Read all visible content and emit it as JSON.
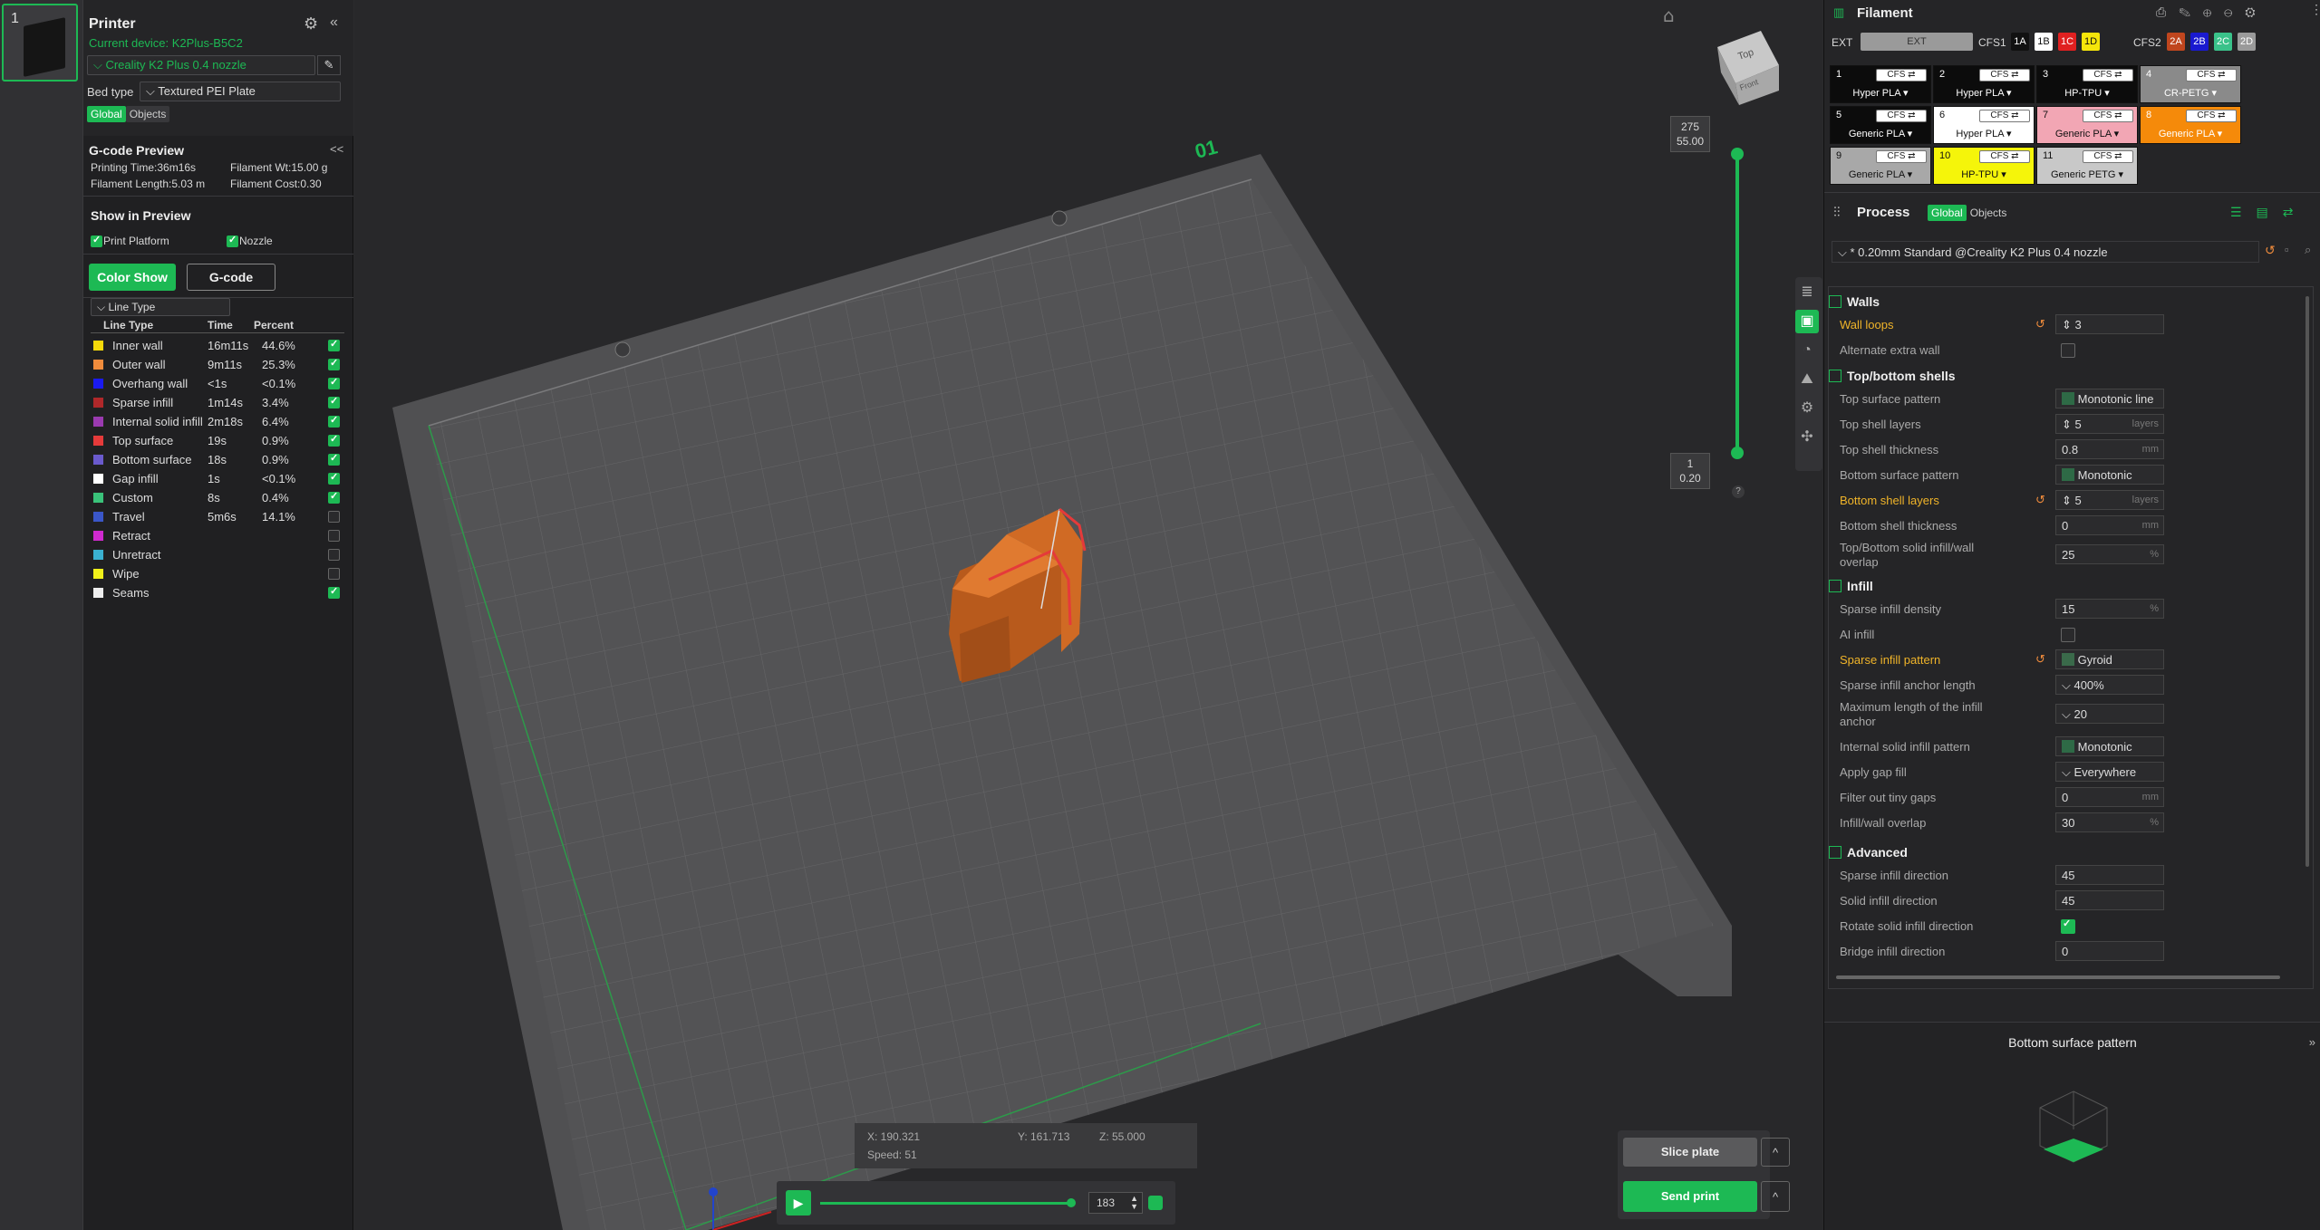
{
  "plate_thumb": {
    "number": "1"
  },
  "printer": {
    "title": "Printer",
    "current_device": "Current device: K2Plus-B5C2",
    "printer_name": "Creality K2 Plus 0.4 nozzle",
    "bed_type_label": "Bed type",
    "bed_type": "Textured PEI Plate",
    "tabs": [
      "Global",
      "Objects"
    ]
  },
  "gcode_preview": {
    "title": "G-code Preview",
    "collapse": "<<",
    "printing_time": "Printing Time:36m16s",
    "filament_wt": "Filament Wt:15.00 g",
    "filament_length": "Filament Length:5.03 m",
    "filament_cost": "Filament Cost:0.30",
    "show_in_preview": "Show in Preview",
    "print_platform": "Print Platform",
    "nozzle": "Nozzle",
    "color_show": "Color Show",
    "gcode": "G-code",
    "line_type_select": "Line Type",
    "table_headers": [
      "Line Type",
      "Time",
      "Percent"
    ],
    "rows": [
      {
        "name": "Inner wall",
        "time": "16m11s",
        "percent": "44.6%",
        "color": "#f5d90a",
        "checked": true
      },
      {
        "name": "Outer wall",
        "time": "9m11s",
        "percent": "25.3%",
        "color": "#f08c3c",
        "checked": true
      },
      {
        "name": "Overhang wall",
        "time": "<1s",
        "percent": "<0.1%",
        "color": "#1a1af0",
        "checked": true
      },
      {
        "name": "Sparse infill",
        "time": "1m14s",
        "percent": "3.4%",
        "color": "#b0282a",
        "checked": true
      },
      {
        "name": "Internal solid infill",
        "time": "2m18s",
        "percent": "6.4%",
        "color": "#9a3ab0",
        "checked": true
      },
      {
        "name": "Top surface",
        "time": "19s",
        "percent": "0.9%",
        "color": "#e53a3a",
        "checked": true
      },
      {
        "name": "Bottom surface",
        "time": "18s",
        "percent": "0.9%",
        "color": "#6a5acd",
        "checked": true
      },
      {
        "name": "Gap infill",
        "time": "1s",
        "percent": "<0.1%",
        "color": "#ffffff",
        "checked": true
      },
      {
        "name": "Custom",
        "time": "8s",
        "percent": "0.4%",
        "color": "#3ac27a",
        "checked": true
      },
      {
        "name": "Travel",
        "time": "5m6s",
        "percent": "14.1%",
        "color": "#3a56c8",
        "checked": false
      },
      {
        "name": "Retract",
        "time": "",
        "percent": "",
        "color": "#d02ad0",
        "checked": false
      },
      {
        "name": "Unretract",
        "time": "",
        "percent": "",
        "color": "#3ab0d0",
        "checked": false
      },
      {
        "name": "Wipe",
        "time": "",
        "percent": "",
        "color": "#f0f01a",
        "checked": false
      },
      {
        "name": "Seams",
        "time": "",
        "percent": "",
        "color": "#eeeeee",
        "checked": true
      }
    ]
  },
  "viewport": {
    "plate_label": "01",
    "view_cube_top": "Top",
    "view_cube_front": "Front",
    "layer_top_num": "275",
    "layer_top_height": "55.00",
    "layer_bottom_num": "1",
    "layer_bottom_height": "0.20",
    "help": "?",
    "coords": {
      "x": "X: 190.321",
      "y": "Y: 161.713",
      "z": "Z: 55.000",
      "speed": "Speed: 51"
    },
    "move_value": "183",
    "slice_plate": "Slice plate",
    "send_print": "Send print",
    "caret": "^"
  },
  "filament": {
    "title": "Filament",
    "ext_label": "EXT",
    "ext_btn": "EXT",
    "cfs1_label": "CFS1",
    "cfs2_label": "CFS2",
    "cfs1_slots": [
      {
        "label": "1A",
        "bg": "#111111",
        "fg": "#ffffff"
      },
      {
        "label": "1B",
        "bg": "#ffffff",
        "fg": "#111111"
      },
      {
        "label": "1C",
        "bg": "#e02020",
        "fg": "#ffffff"
      },
      {
        "label": "1D",
        "bg": "#f5e50a",
        "fg": "#111111"
      }
    ],
    "cfs2_slots": [
      {
        "label": "2A",
        "bg": "#c0461e",
        "fg": "#ffffff"
      },
      {
        "label": "2B",
        "bg": "#1a1ad0",
        "fg": "#ffffff"
      },
      {
        "label": "2C",
        "bg": "#3ac28a",
        "fg": "#ffffff"
      },
      {
        "label": "2D",
        "bg": "#9a9a9a",
        "fg": "#ffffff"
      }
    ],
    "cells": [
      {
        "idx": "1",
        "cfs": "CFS ⇄",
        "mat": "Hyper PLA ▾",
        "bg": "#0c0c0c",
        "fg": "#ffffff"
      },
      {
        "idx": "2",
        "cfs": "CFS ⇄",
        "mat": "Hyper PLA ▾",
        "bg": "#0c0c0c",
        "fg": "#ffffff"
      },
      {
        "idx": "3",
        "cfs": "CFS ⇄",
        "mat": "HP-TPU ▾",
        "bg": "#0c0c0c",
        "fg": "#ffffff"
      },
      {
        "idx": "4",
        "cfs": "CFS ⇄",
        "mat": "CR-PETG ▾",
        "bg": "#8a8a8a",
        "fg": "#ffffff"
      },
      {
        "idx": "5",
        "cfs": "CFS ⇄",
        "mat": "Generic PLA ▾",
        "bg": "#0c0c0c",
        "fg": "#ffffff"
      },
      {
        "idx": "6",
        "cfs": "CFS ⇄",
        "mat": "Hyper PLA ▾",
        "bg": "#ffffff",
        "fg": "#111111"
      },
      {
        "idx": "7",
        "cfs": "CFS ⇄",
        "mat": "Generic PLA ▾",
        "bg": "#f2a6b4",
        "fg": "#111111"
      },
      {
        "idx": "8",
        "cfs": "CFS ⇄",
        "mat": "Generic PLA ▾",
        "bg": "#f58a0a",
        "fg": "#ffffff"
      },
      {
        "idx": "9",
        "cfs": "CFS ⇄",
        "mat": "Generic PLA ▾",
        "bg": "#a8a8a8",
        "fg": "#111111"
      },
      {
        "idx": "10",
        "cfs": "CFS ⇄",
        "mat": "HP-TPU ▾",
        "bg": "#f5f50a",
        "fg": "#111111"
      },
      {
        "idx": "11",
        "cfs": "CFS ⇄",
        "mat": "Generic PETG ▾",
        "bg": "#c8c8c8",
        "fg": "#111111"
      }
    ]
  },
  "process": {
    "title": "Process",
    "tabs": [
      "Global",
      "Objects"
    ],
    "preset": "* 0.20mm Standard @Creality K2 Plus 0.4 nozzle",
    "sections": {
      "walls": "Walls",
      "top_bottom": "Top/bottom shells",
      "infill": "Infill",
      "advanced": "Advanced"
    },
    "rows": {
      "wall_loops": {
        "label": "Wall loops",
        "value": "3"
      },
      "alt_extra_wall": {
        "label": "Alternate extra wall"
      },
      "top_surface_pattern": {
        "label": "Top surface pattern",
        "value": "Monotonic line"
      },
      "top_shell_layers": {
        "label": "Top shell layers",
        "value": "5",
        "unit": "layers"
      },
      "top_shell_thickness": {
        "label": "Top shell thickness",
        "value": "0.8",
        "unit": "mm"
      },
      "bottom_surface_pattern": {
        "label": "Bottom surface pattern",
        "value": "Monotonic"
      },
      "bottom_shell_layers": {
        "label": "Bottom shell layers",
        "value": "5",
        "unit": "layers"
      },
      "bottom_shell_thickness": {
        "label": "Bottom shell thickness",
        "value": "0",
        "unit": "mm"
      },
      "solid_overlap": {
        "label": "Top/Bottom solid infill/wall",
        "label2": "overlap",
        "value": "25",
        "unit": "%"
      },
      "sparse_density": {
        "label": "Sparse infill density",
        "value": "15",
        "unit": "%"
      },
      "ai_infill": {
        "label": "AI infill"
      },
      "sparse_pattern": {
        "label": "Sparse infill pattern",
        "value": "Gyroid"
      },
      "anchor_length": {
        "label": "Sparse infill anchor length",
        "value": "400%"
      },
      "max_anchor": {
        "label": "Maximum length of the infill",
        "label2": "anchor",
        "value": "20"
      },
      "internal_solid_pattern": {
        "label": "Internal solid infill pattern",
        "value": "Monotonic"
      },
      "gap_fill": {
        "label": "Apply gap fill",
        "value": "Everywhere"
      },
      "tiny_gaps": {
        "label": "Filter out tiny gaps",
        "value": "0",
        "unit": "mm"
      },
      "infill_wall_overlap": {
        "label": "Infill/wall overlap",
        "value": "30",
        "unit": "%"
      },
      "sparse_direction": {
        "label": "Sparse infill direction",
        "value": "45"
      },
      "solid_direction": {
        "label": "Solid infill direction",
        "value": "45"
      },
      "rotate_solid": {
        "label": "Rotate solid infill direction"
      },
      "bridge_direction": {
        "label": "Bridge infill direction",
        "value": "0"
      }
    }
  },
  "tooltip": {
    "title": "Bottom surface pattern"
  },
  "colors": {
    "accent": "#1db954",
    "modified": "#f0b429",
    "model": "#c8621e"
  }
}
